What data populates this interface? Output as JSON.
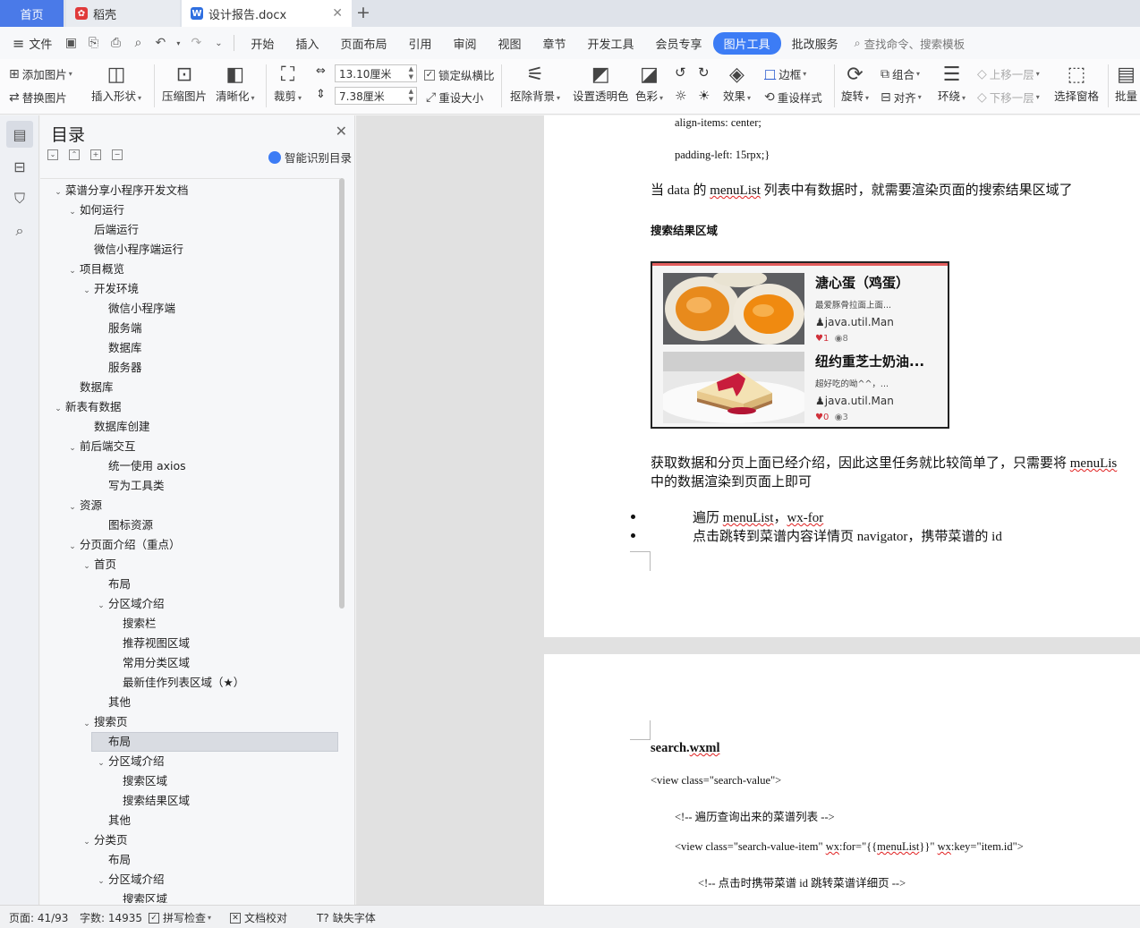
{
  "tabs": {
    "home": "首页",
    "daoke": "稻壳",
    "doc": "设计报告.docx"
  },
  "menu": {
    "file": "文件",
    "items": [
      "开始",
      "插入",
      "页面布局",
      "引用",
      "审阅",
      "视图",
      "章节",
      "开发工具",
      "会员专享"
    ],
    "active": "图片工具",
    "review": "批改服务",
    "search": "查找命令、搜索模板"
  },
  "ribbon": {
    "add_image": "添加图片",
    "replace_image": "替换图片",
    "insert_shape": "插入形状",
    "compress": "压缩图片",
    "sharpen": "清晰化",
    "crop": "裁剪",
    "width": "13.10厘米",
    "height": "7.38厘米",
    "lock_ratio": "锁定纵横比",
    "reset_size": "重设大小",
    "remove_bg": "抠除背景",
    "set_transparent": "设置透明色",
    "color": "色彩",
    "effects": "效果",
    "reset_style": "重设样式",
    "border": "边框",
    "rotate": "旋转",
    "group": "组合",
    "align": "对齐",
    "wrap": "环绕",
    "bring_forward": "上移一层",
    "send_backward": "下移一层",
    "selection_pane": "选择窗格",
    "batch": "批量"
  },
  "nav": {
    "title": "目录",
    "smart": "智能识别目录",
    "toc": [
      {
        "label": "菜谱分享小程序开发文档",
        "level": 0,
        "arrow": true
      },
      {
        "label": "如何运行",
        "level": 1,
        "arrow": true
      },
      {
        "label": "后端运行",
        "level": 2,
        "arrow": false
      },
      {
        "label": "微信小程序端运行",
        "level": 2,
        "arrow": false
      },
      {
        "label": "项目概览",
        "level": 1,
        "arrow": true
      },
      {
        "label": "开发环境",
        "level": 2,
        "arrow": true
      },
      {
        "label": "微信小程序端",
        "level": 3,
        "arrow": false
      },
      {
        "label": "服务端",
        "level": 3,
        "arrow": false
      },
      {
        "label": "数据库",
        "level": 3,
        "arrow": false
      },
      {
        "label": "服务器",
        "level": 3,
        "arrow": false
      },
      {
        "label": "数据库",
        "level": 1,
        "arrow": false
      },
      {
        "label": "新表有数据",
        "level": 0,
        "arrow": true
      },
      {
        "label": "数据库创建",
        "level": 2,
        "arrow": false
      },
      {
        "label": "前后端交互",
        "level": 1,
        "arrow": true
      },
      {
        "label": "统一使用 axios",
        "level": 3,
        "arrow": false
      },
      {
        "label": "写为工具类",
        "level": 3,
        "arrow": false
      },
      {
        "label": "资源",
        "level": 1,
        "arrow": true
      },
      {
        "label": "图标资源",
        "level": 3,
        "arrow": false
      },
      {
        "label": "分页面介绍（重点）",
        "level": 1,
        "arrow": true
      },
      {
        "label": "首页",
        "level": 2,
        "arrow": true
      },
      {
        "label": "布局",
        "level": 3,
        "arrow": false
      },
      {
        "label": "分区域介绍",
        "level": 3,
        "arrow": true
      },
      {
        "label": "搜索栏",
        "level": 4,
        "arrow": false
      },
      {
        "label": "推荐视图区域",
        "level": 4,
        "arrow": false
      },
      {
        "label": "常用分类区域",
        "level": 4,
        "arrow": false
      },
      {
        "label": "最新佳作列表区域（★）",
        "level": 4,
        "arrow": false
      },
      {
        "label": "其他",
        "level": 3,
        "arrow": false
      },
      {
        "label": "搜索页",
        "level": 2,
        "arrow": true
      },
      {
        "label": "布局",
        "level": 3,
        "arrow": false,
        "selected": true
      },
      {
        "label": "分区域介绍",
        "level": 3,
        "arrow": true
      },
      {
        "label": "搜索区域",
        "level": 4,
        "arrow": false
      },
      {
        "label": "搜索结果区域",
        "level": 4,
        "arrow": false
      },
      {
        "label": "其他",
        "level": 3,
        "arrow": false
      },
      {
        "label": "分类页",
        "level": 2,
        "arrow": true
      },
      {
        "label": "布局",
        "level": 3,
        "arrow": false
      },
      {
        "label": "分区域介绍",
        "level": 3,
        "arrow": true
      },
      {
        "label": "搜索区域",
        "level": 4,
        "arrow": false
      }
    ]
  },
  "doc": {
    "code1": "align-items: center;",
    "code2": "padding-left: 15rpx;}",
    "para1_a": "当  data  的  ",
    "para1_b": "menuList",
    "para1_c": "  列表中有数据时，就需要渲染页面的搜索结果区域了",
    "heading": "搜索结果区域",
    "result_items": [
      {
        "name": "溏心蛋（鸡蛋）",
        "desc": "最爱豚骨拉面上面...",
        "author": "java.util.Man",
        "likes": "1",
        "views": "8"
      },
      {
        "name": "纽约重芝士奶油...",
        "desc": "超好吃的呦^^，...",
        "author": "java.util.Man",
        "likes": "0",
        "views": "3"
      }
    ],
    "para2_a": "获取数据和分页上面已经介绍，因此这里任务就比较简单了，只需要将  ",
    "para2_b": "menuLis",
    "para2_c": "中的数据渲染到页面上即可",
    "bullet1_a": "遍历  ",
    "bullet1_b": "menuList",
    "bullet1_c": "，",
    "bullet1_d": "wx-for",
    "bullet2": "点击跳转到菜谱内容详情页  navigator，携带菜谱的  id",
    "p2_title_a": "search.",
    "p2_title_b": "wxml",
    "p2_line1": "<view class=\"search-value\">",
    "p2_line2": "<!--  遍历查询出来的菜谱列表  -->",
    "p2_line3_a": "<view class=\"search-value-item\" ",
    "p2_line3_b": "wx",
    "p2_line3_c": ":for=\"{{",
    "p2_line3_d": "menuList",
    "p2_line3_e": "}}\" ",
    "p2_line3_f": "wx",
    "p2_line3_g": ":key=\"item.id\">",
    "p2_line4": "<!--  点击时携带菜谱 id 跳转菜谱详细页  -->"
  },
  "status": {
    "page": "页面: 41/93",
    "words": "字数: 14935",
    "spell": "拼写检查",
    "proof": "文档校对",
    "missing_font": "缺失字体"
  },
  "colors": {
    "accent": "#3c7cf5",
    "home_tab": "#4a7ae8",
    "daoke_icon": "#e03a3a",
    "doc_icon": "#2f6fe0",
    "result_top_bar": "#e35d5d",
    "like_heart": "#d0303a"
  },
  "icons": {
    "remove_bg": "magic-wand-icon",
    "crop": "crop-icon",
    "rotate": "rotate-icon",
    "search": "search-icon"
  }
}
